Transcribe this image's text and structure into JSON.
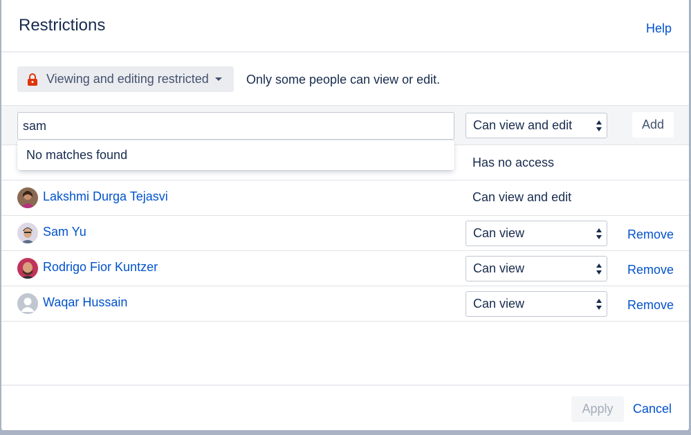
{
  "dialog": {
    "title": "Restrictions",
    "help_label": "Help"
  },
  "mode": {
    "label": "Viewing and editing restricted",
    "description": "Only some people can view or edit."
  },
  "add_row": {
    "search_value": "sam",
    "permission": "Can view and edit",
    "add_label": "Add"
  },
  "dropdown": {
    "no_results": "No matches found"
  },
  "rows": [
    {
      "name": "",
      "permission": "Has no access"
    },
    {
      "name": "Lakshmi Durga Tejasvi",
      "permission": "Can view and edit"
    },
    {
      "name": "Sam Yu",
      "permission": "Can view",
      "action": "Remove"
    },
    {
      "name": "Rodrigo Fior Kuntzer",
      "permission": "Can view",
      "action": "Remove"
    },
    {
      "name": "Waqar Hussain",
      "permission": "Can view",
      "action": "Remove"
    }
  ],
  "footer": {
    "apply_label": "Apply",
    "cancel_label": "Cancel"
  },
  "colors": {
    "link": "#0052cc",
    "text": "#172b4d",
    "lock": "#de350b",
    "overlay": "#a9b3c4"
  },
  "icons": {
    "mode": "lock-icon",
    "caret": "chevron-down-icon",
    "select": "select-arrows-icon"
  }
}
